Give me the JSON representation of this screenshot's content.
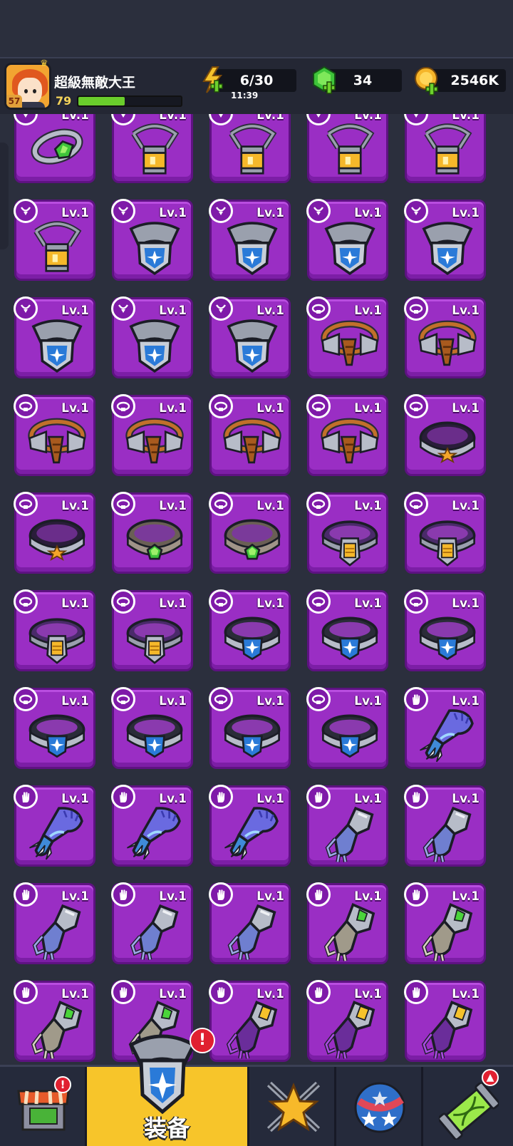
{
  "player": {
    "name": "超級無敵大王",
    "level": "79",
    "vip": "57",
    "exp_fraction": 0.45
  },
  "resources": {
    "energy": "6/30",
    "energy_timer": "11:39",
    "gems": "34",
    "gold": "2546K"
  },
  "colors": {
    "card_bg": "#9a2ec4",
    "card_border": "#5e1282",
    "active_tab": "#f7c52a",
    "exp": "#6acd2c"
  },
  "items": [
    {
      "slot": "necklace",
      "art": "ring-gem",
      "level": "Lv.1"
    },
    {
      "slot": "necklace",
      "art": "lantern-chain",
      "level": "Lv.1"
    },
    {
      "slot": "necklace",
      "art": "lantern-chain",
      "level": "Lv.1"
    },
    {
      "slot": "necklace",
      "art": "lantern-chain",
      "level": "Lv.1"
    },
    {
      "slot": "necklace",
      "art": "lantern-chain",
      "level": "Lv.1"
    },
    {
      "slot": "necklace",
      "art": "lantern-chain",
      "level": "Lv.1"
    },
    {
      "slot": "necklace",
      "art": "shield-pendant",
      "level": "Lv.1"
    },
    {
      "slot": "necklace",
      "art": "shield-pendant",
      "level": "Lv.1"
    },
    {
      "slot": "necklace",
      "art": "shield-pendant",
      "level": "Lv.1"
    },
    {
      "slot": "necklace",
      "art": "shield-pendant",
      "level": "Lv.1"
    },
    {
      "slot": "necklace",
      "art": "shield-pendant",
      "level": "Lv.1"
    },
    {
      "slot": "necklace",
      "art": "shield-pendant",
      "level": "Lv.1"
    },
    {
      "slot": "necklace",
      "art": "shield-pendant",
      "level": "Lv.1"
    },
    {
      "slot": "belt",
      "art": "rope-belt",
      "level": "Lv.1"
    },
    {
      "slot": "belt",
      "art": "rope-belt",
      "level": "Lv.1"
    },
    {
      "slot": "belt",
      "art": "rope-belt",
      "level": "Lv.1"
    },
    {
      "slot": "belt",
      "art": "rope-belt",
      "level": "Lv.1"
    },
    {
      "slot": "belt",
      "art": "rope-belt",
      "level": "Lv.1"
    },
    {
      "slot": "belt",
      "art": "rope-belt",
      "level": "Lv.1"
    },
    {
      "slot": "belt",
      "art": "star-belt",
      "level": "Lv.1"
    },
    {
      "slot": "belt",
      "art": "star-belt",
      "level": "Lv.1"
    },
    {
      "slot": "belt",
      "art": "gem-belt",
      "level": "Lv.1"
    },
    {
      "slot": "belt",
      "art": "gem-belt",
      "level": "Lv.1"
    },
    {
      "slot": "belt",
      "art": "gold-belt",
      "level": "Lv.1"
    },
    {
      "slot": "belt",
      "art": "gold-belt",
      "level": "Lv.1"
    },
    {
      "slot": "belt",
      "art": "gold-belt",
      "level": "Lv.1"
    },
    {
      "slot": "belt",
      "art": "gold-belt",
      "level": "Lv.1"
    },
    {
      "slot": "belt",
      "art": "blue-belt",
      "level": "Lv.1"
    },
    {
      "slot": "belt",
      "art": "blue-belt",
      "level": "Lv.1"
    },
    {
      "slot": "belt",
      "art": "blue-belt",
      "level": "Lv.1"
    },
    {
      "slot": "belt",
      "art": "blue-belt",
      "level": "Lv.1"
    },
    {
      "slot": "belt",
      "art": "blue-belt",
      "level": "Lv.1"
    },
    {
      "slot": "belt",
      "art": "blue-belt",
      "level": "Lv.1"
    },
    {
      "slot": "belt",
      "art": "blue-belt",
      "level": "Lv.1"
    },
    {
      "slot": "glove",
      "art": "claw-glove",
      "level": "Lv.1"
    },
    {
      "slot": "glove",
      "art": "claw-glove",
      "level": "Lv.1"
    },
    {
      "slot": "glove",
      "art": "claw-glove",
      "level": "Lv.1"
    },
    {
      "slot": "glove",
      "art": "claw-glove",
      "level": "Lv.1"
    },
    {
      "slot": "glove",
      "art": "steel-glove",
      "level": "Lv.1"
    },
    {
      "slot": "glove",
      "art": "steel-glove",
      "level": "Lv.1"
    },
    {
      "slot": "glove",
      "art": "steel-glove",
      "level": "Lv.1"
    },
    {
      "slot": "glove",
      "art": "steel-glove",
      "level": "Lv.1"
    },
    {
      "slot": "glove",
      "art": "steel-glove",
      "level": "Lv.1"
    },
    {
      "slot": "glove",
      "art": "green-glove",
      "level": "Lv.1"
    },
    {
      "slot": "glove",
      "art": "green-glove",
      "level": "Lv.1"
    },
    {
      "slot": "glove",
      "art": "green-glove",
      "level": "Lv.1"
    },
    {
      "slot": "glove",
      "art": "green-glove",
      "level": "Lv.1"
    },
    {
      "slot": "glove",
      "art": "purple-glove",
      "level": "Lv.1"
    },
    {
      "slot": "glove",
      "art": "purple-glove",
      "level": "Lv.1"
    },
    {
      "slot": "glove",
      "art": "purple-glove",
      "level": "Lv.1"
    }
  ],
  "nav": {
    "equip_label": "装备",
    "tabs": [
      "shop",
      "equipment",
      "battle",
      "orb",
      "gene"
    ]
  }
}
